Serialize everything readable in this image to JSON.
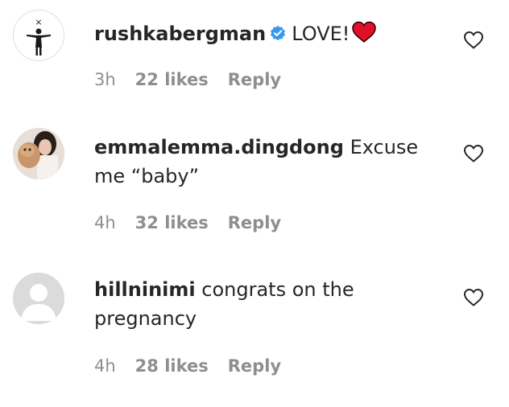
{
  "comments": [
    {
      "username": "rushkabergman",
      "verified": true,
      "text": "LOVE!",
      "emoji": "red-heart",
      "time": "3h",
      "likes": "22 likes",
      "reply": "Reply"
    },
    {
      "username": "emmalemma.dingdong",
      "verified": false,
      "text": "Excuse me “baby”",
      "time": "4h",
      "likes": "32 likes",
      "reply": "Reply"
    },
    {
      "username": "hillninimi",
      "verified": false,
      "text": "congrats on the pregnancy",
      "time": "4h",
      "likes": "28 likes",
      "reply": "Reply"
    }
  ],
  "colors": {
    "text": "#262626",
    "meta": "#8e8e8e",
    "verified": "#3897f0",
    "heart": "#e0102a",
    "default_avatar": "#dbdbdb"
  },
  "icons": {
    "verified": "verified-badge-icon",
    "like": "heart-outline-icon",
    "emoji": "red-heart-emoji-icon"
  }
}
